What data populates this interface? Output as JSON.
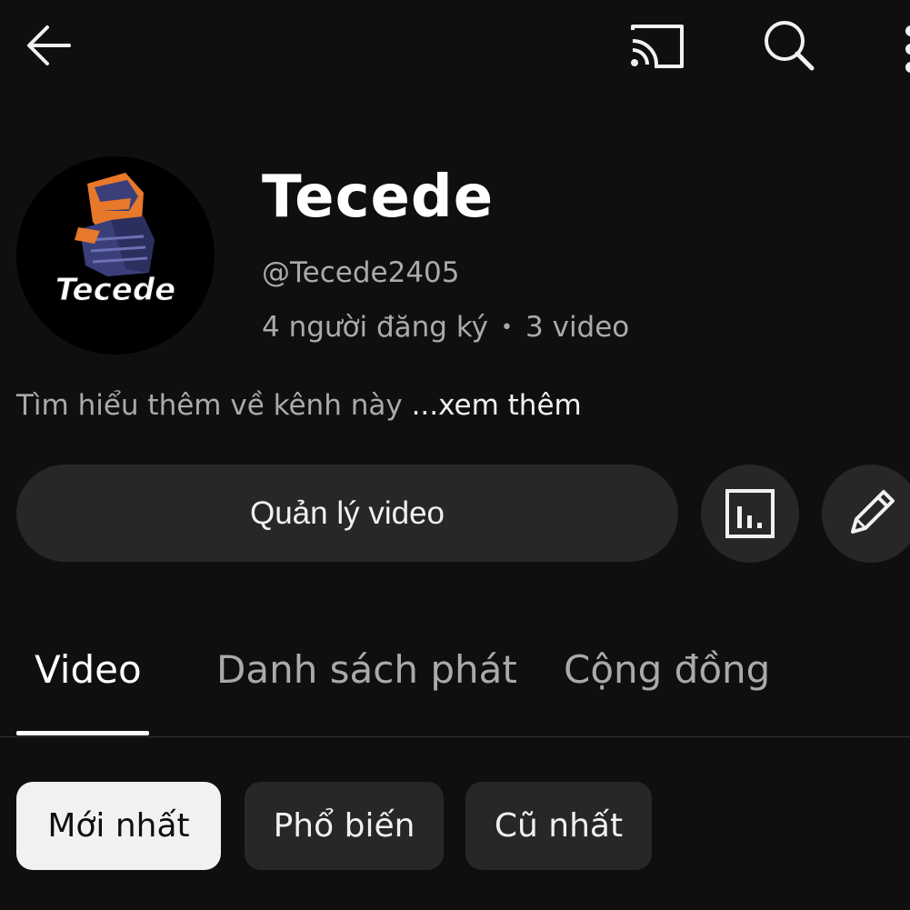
{
  "topbar": {
    "back_icon": "arrow-left-icon",
    "cast_icon": "cast-icon",
    "search_icon": "search-icon",
    "more_icon": "more-vertical-icon"
  },
  "channel": {
    "name": "Tecede",
    "handle": "@Tecede2405",
    "subscribers": "4 người đăng ký",
    "separator": "•",
    "video_count": "3 video",
    "description": "Tìm hiểu thêm về kênh này",
    "more_link": "...xem thêm",
    "avatar_text": "Tecede"
  },
  "actions": {
    "manage_label": "Quản lý video",
    "analytics_icon": "analytics-icon",
    "edit_icon": "pencil-icon"
  },
  "tabs": [
    {
      "label": "Video",
      "selected": true
    },
    {
      "label": "Danh sách phát",
      "selected": false
    },
    {
      "label": "Cộng đồng",
      "selected": false
    }
  ],
  "chips": [
    {
      "label": "Mới nhất",
      "selected": true
    },
    {
      "label": "Phổ biến",
      "selected": false
    },
    {
      "label": "Cũ nhất",
      "selected": false
    }
  ],
  "colors": {
    "background": "#0f0f0f",
    "surface": "#272727",
    "text_primary": "#f1f1f1",
    "text_secondary": "#aaaaaa",
    "avatar_accent": "#e8782a",
    "avatar_armor": "#3a3f7a"
  }
}
